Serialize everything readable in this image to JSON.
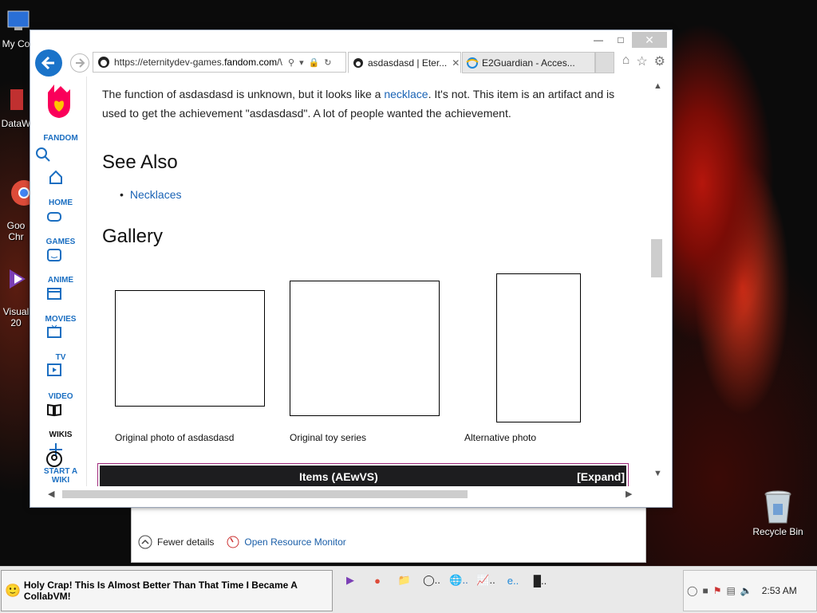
{
  "desktop": {
    "icons": [
      {
        "name": "my-computer",
        "label": "My Co"
      },
      {
        "name": "dataw",
        "label": "DataW"
      },
      {
        "name": "google-chrome",
        "label": "Goo\nChr"
      },
      {
        "name": "visual-studio",
        "label": "Visual\n20"
      },
      {
        "name": "recycle-bin",
        "label": "Recycle Bin"
      }
    ]
  },
  "browser": {
    "url_prefix": "https://eternitydev-games.",
    "url_domain": "fandom.com",
    "url_suffix": "/\\",
    "tabs": [
      {
        "label": "asdasdasd | Eter...",
        "active": true
      },
      {
        "label": "E2Guardian - Acces...",
        "active": false
      }
    ]
  },
  "fandom_rail": {
    "brand": "FANDOM",
    "items": [
      "HOME",
      "GAMES",
      "ANIME",
      "MOVIES",
      "TV",
      "VIDEO",
      "WIKIS",
      "START A WIKI"
    ]
  },
  "article": {
    "para_start": "The function of asdasdasd is unknown, but it looks like a ",
    "para_link": "necklace",
    "para_end": ". It's not. This item is an artifact and is used to get the achievement \"asdasdasd\". A lot of people wanted the achievement.",
    "see_also_heading": "See Also",
    "see_also_items": [
      "Necklaces"
    ],
    "gallery_heading": "Gallery",
    "gallery": [
      {
        "caption": "Original photo of asdasdasd"
      },
      {
        "caption": "Original toy series"
      },
      {
        "caption": "Alternative photo"
      }
    ],
    "navbox_title": "Items (AEwVS)",
    "navbox_toggle": "[Expand]"
  },
  "task_manager": {
    "fewer_details": "Fewer details",
    "open_resource_monitor": "Open Resource Monitor"
  },
  "taskbar": {
    "window_title": "Holy Crap! This Is Almost Better Than That Time I Became A CollabVM!",
    "clock": "2:53 AM"
  },
  "colors": {
    "link": "#1a63b5",
    "fandom_blue": "#1a6ec1",
    "fandom_flame": "#fa005a",
    "ie_blue": "#1a73c9"
  }
}
